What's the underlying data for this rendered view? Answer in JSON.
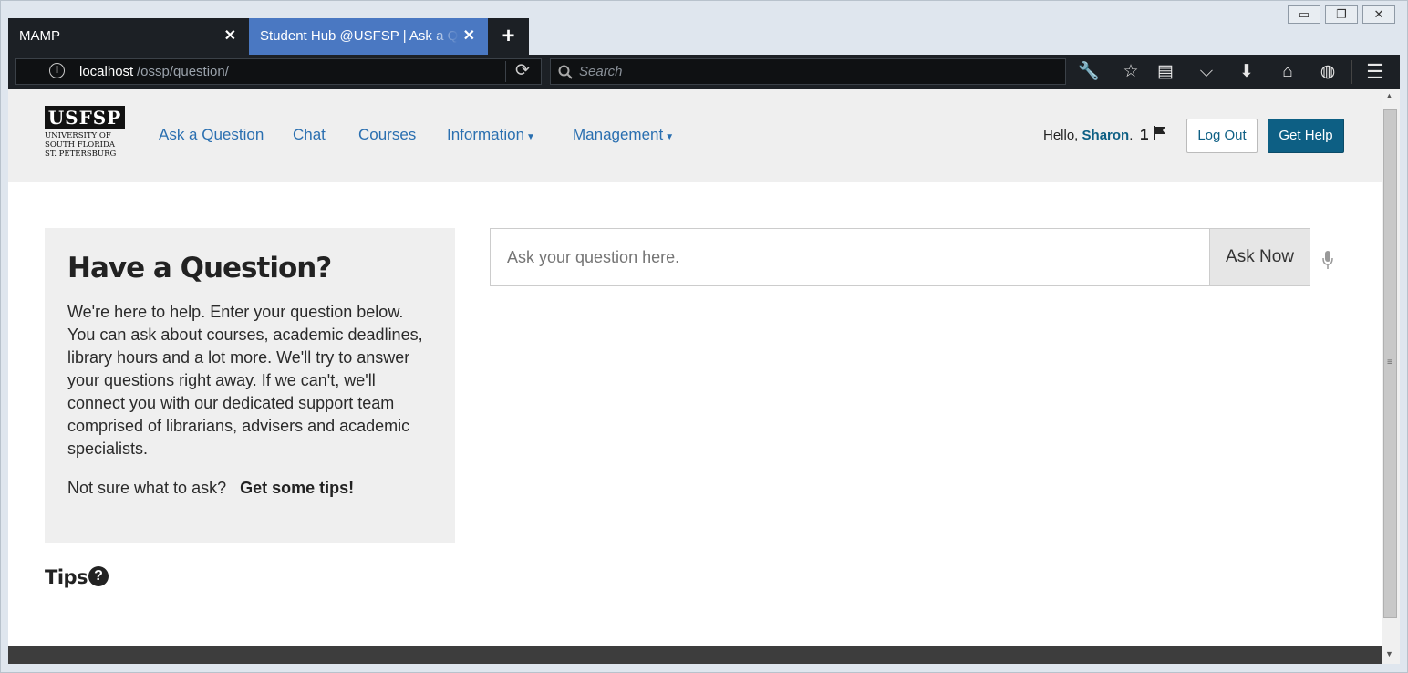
{
  "browser": {
    "tabs": [
      {
        "label": "MAMP",
        "active": false
      },
      {
        "label": "Student Hub @USFSP | Ask a Question",
        "active": true
      }
    ],
    "new_tab_label": "+",
    "url_host": "localhost",
    "url_path": "/ossp/question/",
    "search_placeholder": "Search",
    "window_controls": {
      "minimize": "▭",
      "restore": "❐",
      "close": "✕"
    }
  },
  "site": {
    "logo": {
      "brand": "USFSP",
      "line1": "UNIVERSITY OF",
      "line2": "SOUTH FLORIDA",
      "line3": "ST. PETERSBURG"
    },
    "nav": [
      {
        "label": "Ask a Question",
        "dropdown": false
      },
      {
        "label": "Chat",
        "dropdown": false
      },
      {
        "label": "Courses",
        "dropdown": false
      },
      {
        "label": "Information",
        "dropdown": true
      },
      {
        "label": "Management",
        "dropdown": true
      }
    ],
    "greeting_prefix": "Hello,",
    "user_name": "Sharon",
    "greeting_suffix": ".",
    "flag_count": "1",
    "logout_label": "Log Out",
    "help_label": "Get Help"
  },
  "main": {
    "heading": "Have a Question?",
    "body": "We're here to help. Enter your question below. You can ask about courses, academic deadlines, library hours and a lot more. We'll try to answer your questions right away. If we can't, we'll connect you with our dedicated support team comprised of librarians, advisers and academic specialists.",
    "not_sure": "Not sure what to ask?",
    "tips_link": "Get some tips!",
    "input_placeholder": "Ask your question here.",
    "ask_button": "Ask Now",
    "tips_heading": "Tips"
  },
  "colors": {
    "accent": "#0d5f84",
    "link": "#2a6fb0",
    "tab_active": "#4a78c2"
  }
}
